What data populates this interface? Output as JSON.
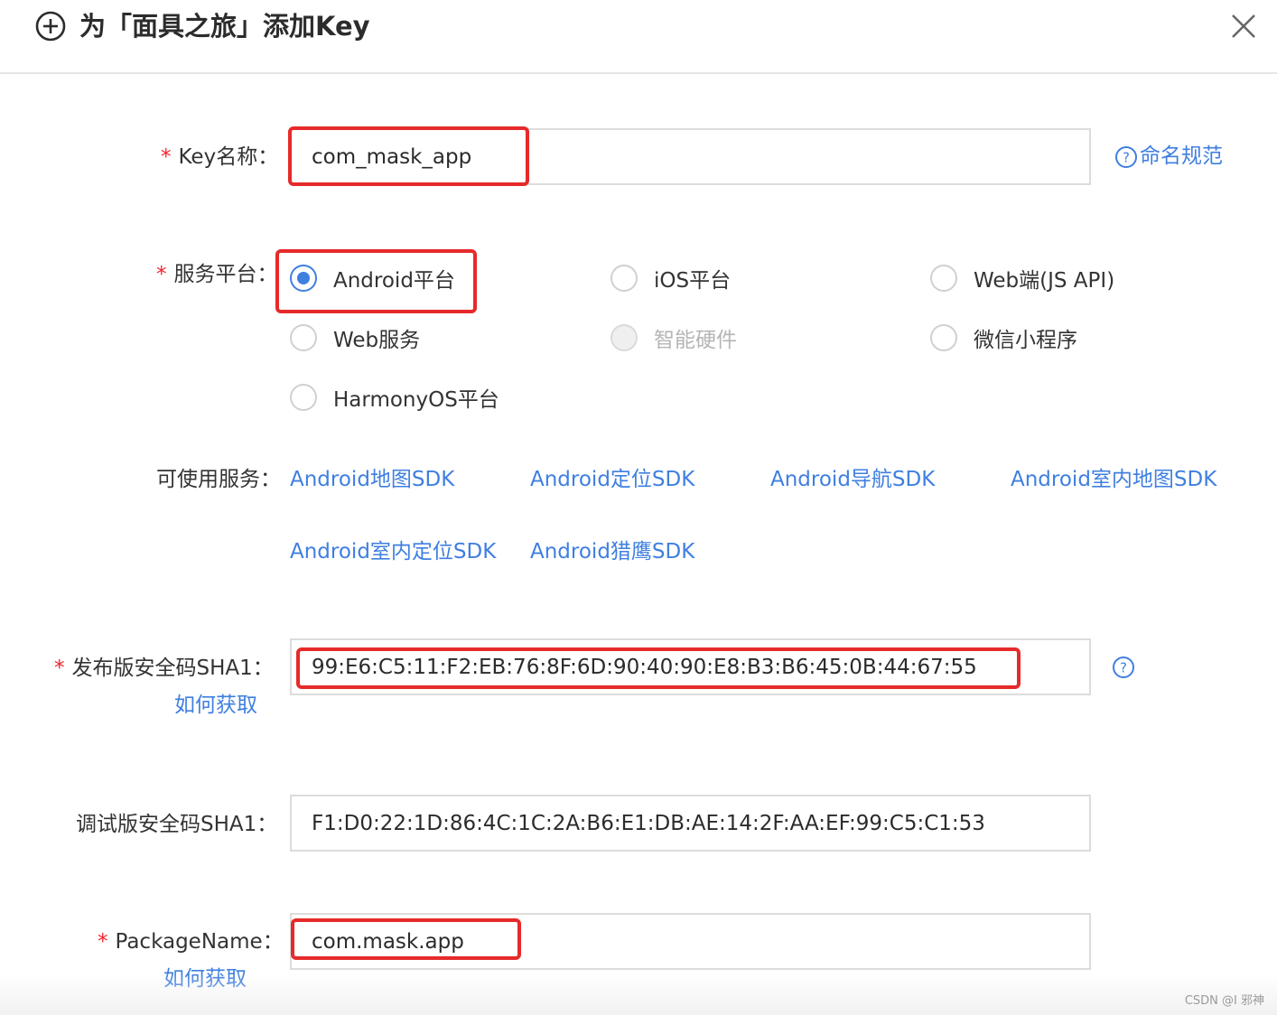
{
  "header": {
    "icon": "add-circle-icon",
    "title": "为「面具之旅」添加Key",
    "close_icon": "close-icon"
  },
  "form": {
    "key_name": {
      "label": "Key名称：",
      "value": "com_mask_app",
      "help_link": "命名规范",
      "help_icon": "question-circle-icon"
    },
    "platform": {
      "label": "服务平台：",
      "options": [
        {
          "label": "Android平台",
          "checked": true,
          "disabled": false
        },
        {
          "label": "iOS平台",
          "checked": false,
          "disabled": false
        },
        {
          "label": "Web端(JS API)",
          "checked": false,
          "disabled": false
        },
        {
          "label": "Web服务",
          "checked": false,
          "disabled": false
        },
        {
          "label": "智能硬件",
          "checked": false,
          "disabled": true
        },
        {
          "label": "微信小程序",
          "checked": false,
          "disabled": false
        },
        {
          "label": "HarmonyOS平台",
          "checked": false,
          "disabled": false
        }
      ]
    },
    "services": {
      "label": "可使用服务：",
      "links": [
        "Android地图SDK",
        "Android定位SDK",
        "Android导航SDK",
        "Android室内地图SDK",
        "Android室内定位SDK",
        "Android猎鹰SDK"
      ]
    },
    "release_sha1": {
      "label": "发布版安全码SHA1：",
      "value": "99:E6:C5:11:F2:EB:76:8F:6D:90:40:90:E8:B3:B6:45:0B:44:67:55",
      "how_link": "如何获取",
      "help_icon": "question-circle-icon"
    },
    "debug_sha1": {
      "label": "调试版安全码SHA1：",
      "value": "F1:D0:22:1D:86:4C:1C:2A:B6:E1:DB:AE:14:2F:AA:EF:99:C5:C1:53"
    },
    "package_name": {
      "label": "PackageName：",
      "value": "com.mask.app",
      "how_link": "如何获取"
    }
  },
  "watermark": "CSDN @I 邪神",
  "colors": {
    "accent": "#3f7fe0",
    "required": "#f5222d",
    "highlight": "#e62a2a",
    "border": "#dcdcdc"
  }
}
